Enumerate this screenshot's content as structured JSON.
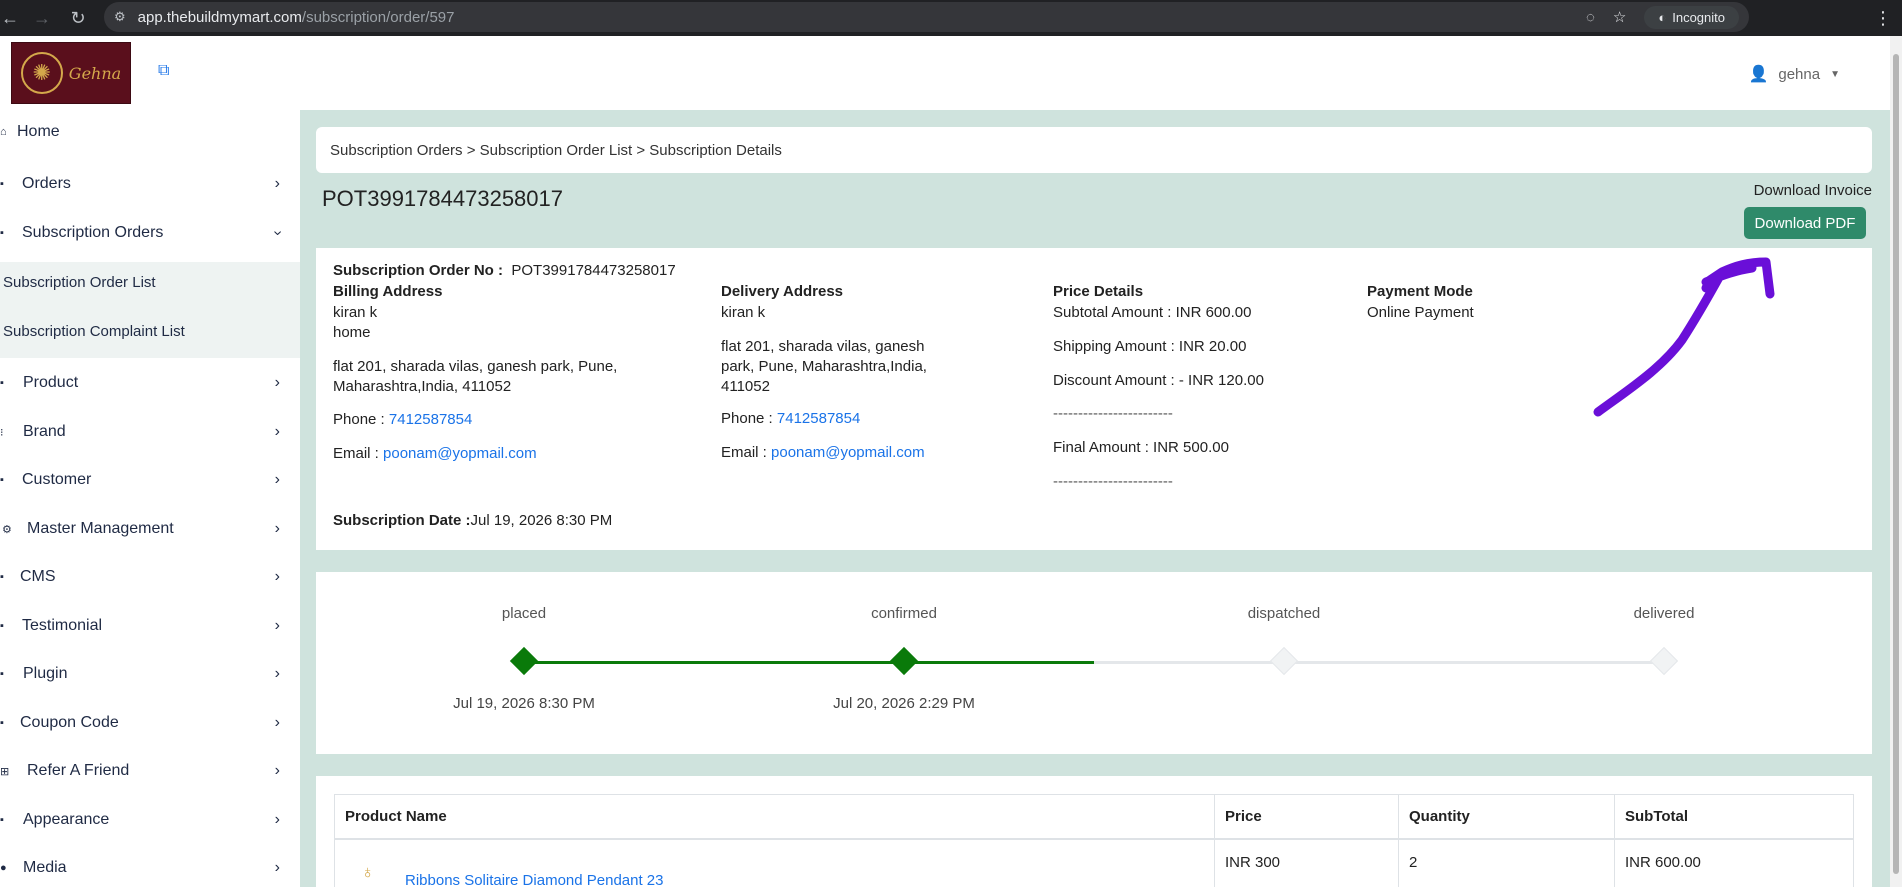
{
  "browser": {
    "url_host": "app.thebuildmymart.com",
    "url_path": "/subscription/order/597",
    "incognito_label": "Incognito"
  },
  "header": {
    "logo_text": "Gehna",
    "user_name": "gehna"
  },
  "sidebar": {
    "items": [
      {
        "label": "Home",
        "icon": "home-icon",
        "has_chevron": false
      },
      {
        "label": "Orders",
        "icon": "orders-icon",
        "has_chevron": true
      },
      {
        "label": "Subscription Orders",
        "icon": "subscription-icon",
        "has_chevron": true
      },
      {
        "label": "Product",
        "icon": "product-icon",
        "has_chevron": true
      },
      {
        "label": "Brand",
        "icon": "brand-icon",
        "has_chevron": true
      },
      {
        "label": "Customer",
        "icon": "customer-icon",
        "has_chevron": true
      },
      {
        "label": "Master Management",
        "icon": "gear-icon",
        "has_chevron": true
      },
      {
        "label": "CMS",
        "icon": "cms-icon",
        "has_chevron": true
      },
      {
        "label": "Testimonial",
        "icon": "testimonial-icon",
        "has_chevron": true
      },
      {
        "label": "Plugin",
        "icon": "plugin-icon",
        "has_chevron": true
      },
      {
        "label": "Coupon Code",
        "icon": "coupon-icon",
        "has_chevron": true
      },
      {
        "label": "Refer A Friend",
        "icon": "refer-icon",
        "has_chevron": true
      },
      {
        "label": "Appearance",
        "icon": "appearance-icon",
        "has_chevron": true
      },
      {
        "label": "Media",
        "icon": "media-icon",
        "has_chevron": true
      }
    ],
    "subitems": [
      "Subscription Order List",
      "Subscription Complaint List"
    ]
  },
  "breadcrumb": "Subscription Orders > Subscription Order List > Subscription Details",
  "order_title": "POT3991784473258017",
  "download": {
    "label": "Download Invoice",
    "button": "Download PDF"
  },
  "details": {
    "order_no_label": "Subscription Order No :",
    "order_no": "POT3991784473258017",
    "billing": {
      "heading": "Billing Address",
      "name": "kiran k",
      "type": "home",
      "address_line1": "flat 201, sharada vilas, ganesh park, Pune,",
      "address_line2": "Maharashtra,India, 411052",
      "phone_label": "Phone :",
      "phone": "7412587854",
      "email_label": "Email :",
      "email": "poonam@yopmail.com"
    },
    "delivery": {
      "heading": "Delivery Address",
      "name": "kiran k",
      "address_line1": "flat 201, sharada vilas, ganesh",
      "address_line2": "park, Pune, Maharashtra,India,",
      "address_line3": "411052",
      "phone_label": "Phone :",
      "phone": "7412587854",
      "email_label": "Email :",
      "email": "poonam@yopmail.com"
    },
    "price": {
      "heading": "Price Details",
      "subtotal": "Subtotal Amount : INR 600.00",
      "shipping": "Shipping Amount : INR 20.00",
      "discount": "Discount Amount : - INR 120.00",
      "separator": "------------------------",
      "final": "Final Amount : INR  500.00"
    },
    "payment": {
      "heading": "Payment Mode",
      "mode": "Online Payment"
    },
    "date_label": "Subscription Date :",
    "date": "Jul 19, 2026 8:30 PM"
  },
  "tracker": {
    "steps": [
      {
        "label": "placed",
        "date": "Jul 19, 2026 8:30 PM",
        "done": true
      },
      {
        "label": "confirmed",
        "date": "Jul 20, 2026 2:29 PM",
        "done": true
      },
      {
        "label": "dispatched",
        "date": "",
        "done": false
      },
      {
        "label": "delivered",
        "date": "",
        "done": false
      }
    ],
    "colors": {
      "done": "#0a7a0a",
      "pending": "#e4e7ea"
    }
  },
  "table": {
    "headers": [
      "Product Name",
      "Price",
      "Quantity",
      "SubTotal"
    ],
    "rows": [
      {
        "name": "Ribbons Solitaire Diamond Pendant 23",
        "price": "INR 300",
        "quantity": "2",
        "subtotal": "INR 600.00"
      }
    ]
  },
  "colors": {
    "accent": "#2f8a6a",
    "main_bg": "#cfe3dd",
    "link": "#1a73e8",
    "annotation": "#6a0fd8"
  }
}
